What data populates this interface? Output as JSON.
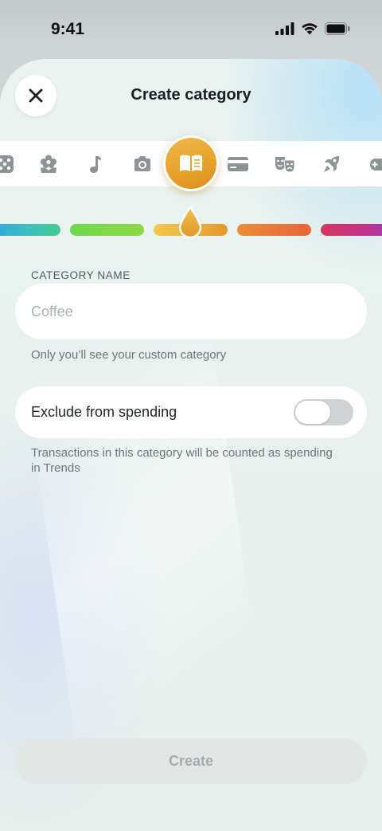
{
  "status_bar": {
    "time": "9:41"
  },
  "header": {
    "title": "Create category"
  },
  "icon_picker": {
    "icons": [
      "dice-icon",
      "flower-icon",
      "music-note-icon",
      "camera-icon",
      "book-icon",
      "credit-card-icon",
      "theater-masks-icon",
      "rocket-icon",
      "game-controller-icon"
    ],
    "selected": "book-icon",
    "selected_color": "#e9a52e"
  },
  "color_picker": {
    "colors": [
      "#3ec1b8",
      "#7ed64a",
      "#e9b23a",
      "#ec7a36",
      "#d8365e"
    ],
    "selected": "#e9b23a"
  },
  "name_field": {
    "label": "CATEGORY NAME",
    "placeholder": "Coffee",
    "value": "",
    "help": "Only you’ll see your custom category"
  },
  "exclude_toggle": {
    "label": "Exclude from spending",
    "checked": false,
    "help": "Transactions in this category will be counted as spending in Trends"
  },
  "footer": {
    "create_label": "Create"
  }
}
